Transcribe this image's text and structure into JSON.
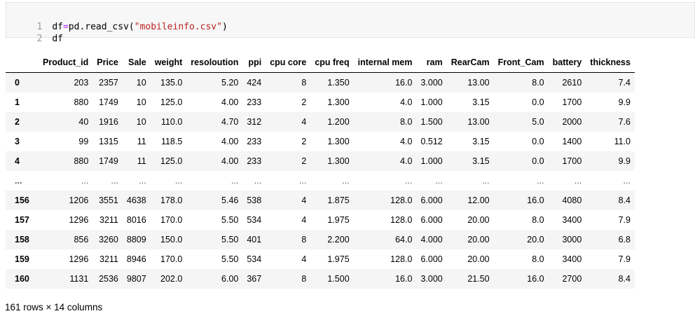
{
  "code_cell": {
    "lines": [
      {
        "number": "1",
        "var": "df",
        "op": "=",
        "call": "pd.read_csv(",
        "arg": "\"mobileinfo.csv\"",
        "close": ")"
      },
      {
        "number": "2",
        "var": "df"
      }
    ]
  },
  "dataframe": {
    "columns": [
      "Product_id",
      "Price",
      "Sale",
      "weight",
      "resoloution",
      "ppi",
      "cpu core",
      "cpu freq",
      "internal mem",
      "ram",
      "RearCam",
      "Front_Cam",
      "battery",
      "thickness"
    ],
    "rows": [
      {
        "index": "0",
        "cells": [
          "203",
          "2357",
          "10",
          "135.0",
          "5.20",
          "424",
          "8",
          "1.350",
          "16.0",
          "3.000",
          "13.00",
          "8.0",
          "2610",
          "7.4"
        ]
      },
      {
        "index": "1",
        "cells": [
          "880",
          "1749",
          "10",
          "125.0",
          "4.00",
          "233",
          "2",
          "1.300",
          "4.0",
          "1.000",
          "3.15",
          "0.0",
          "1700",
          "9.9"
        ]
      },
      {
        "index": "2",
        "cells": [
          "40",
          "1916",
          "10",
          "110.0",
          "4.70",
          "312",
          "4",
          "1.200",
          "8.0",
          "1.500",
          "13.00",
          "5.0",
          "2000",
          "7.6"
        ]
      },
      {
        "index": "3",
        "cells": [
          "99",
          "1315",
          "11",
          "118.5",
          "4.00",
          "233",
          "2",
          "1.300",
          "4.0",
          "0.512",
          "3.15",
          "0.0",
          "1400",
          "11.0"
        ]
      },
      {
        "index": "4",
        "cells": [
          "880",
          "1749",
          "11",
          "125.0",
          "4.00",
          "233",
          "2",
          "1.300",
          "4.0",
          "1.000",
          "3.15",
          "0.0",
          "1700",
          "9.9"
        ]
      },
      {
        "index": "...",
        "cells": [
          "...",
          "...",
          "...",
          "...",
          "...",
          "...",
          "...",
          "...",
          "...",
          "...",
          "...",
          "...",
          "...",
          "..."
        ]
      },
      {
        "index": "156",
        "cells": [
          "1206",
          "3551",
          "4638",
          "178.0",
          "5.46",
          "538",
          "4",
          "1.875",
          "128.0",
          "6.000",
          "12.00",
          "16.0",
          "4080",
          "8.4"
        ]
      },
      {
        "index": "157",
        "cells": [
          "1296",
          "3211",
          "8016",
          "170.0",
          "5.50",
          "534",
          "4",
          "1.975",
          "128.0",
          "6.000",
          "20.00",
          "8.0",
          "3400",
          "7.9"
        ]
      },
      {
        "index": "158",
        "cells": [
          "856",
          "3260",
          "8809",
          "150.0",
          "5.50",
          "401",
          "8",
          "2.200",
          "64.0",
          "4.000",
          "20.00",
          "20.0",
          "3000",
          "6.8"
        ]
      },
      {
        "index": "159",
        "cells": [
          "1296",
          "3211",
          "8946",
          "170.0",
          "5.50",
          "534",
          "4",
          "1.975",
          "128.0",
          "6.000",
          "20.00",
          "8.0",
          "3400",
          "7.9"
        ]
      },
      {
        "index": "160",
        "cells": [
          "1131",
          "2536",
          "9807",
          "202.0",
          "6.00",
          "367",
          "8",
          "1.500",
          "16.0",
          "3.000",
          "21.50",
          "16.0",
          "2700",
          "8.4"
        ]
      }
    ],
    "shape_text": "161 rows × 14 columns"
  },
  "colors": {
    "string": "#ba2121",
    "operator": "#aa22ff",
    "stripe": "#f5f5f5"
  }
}
